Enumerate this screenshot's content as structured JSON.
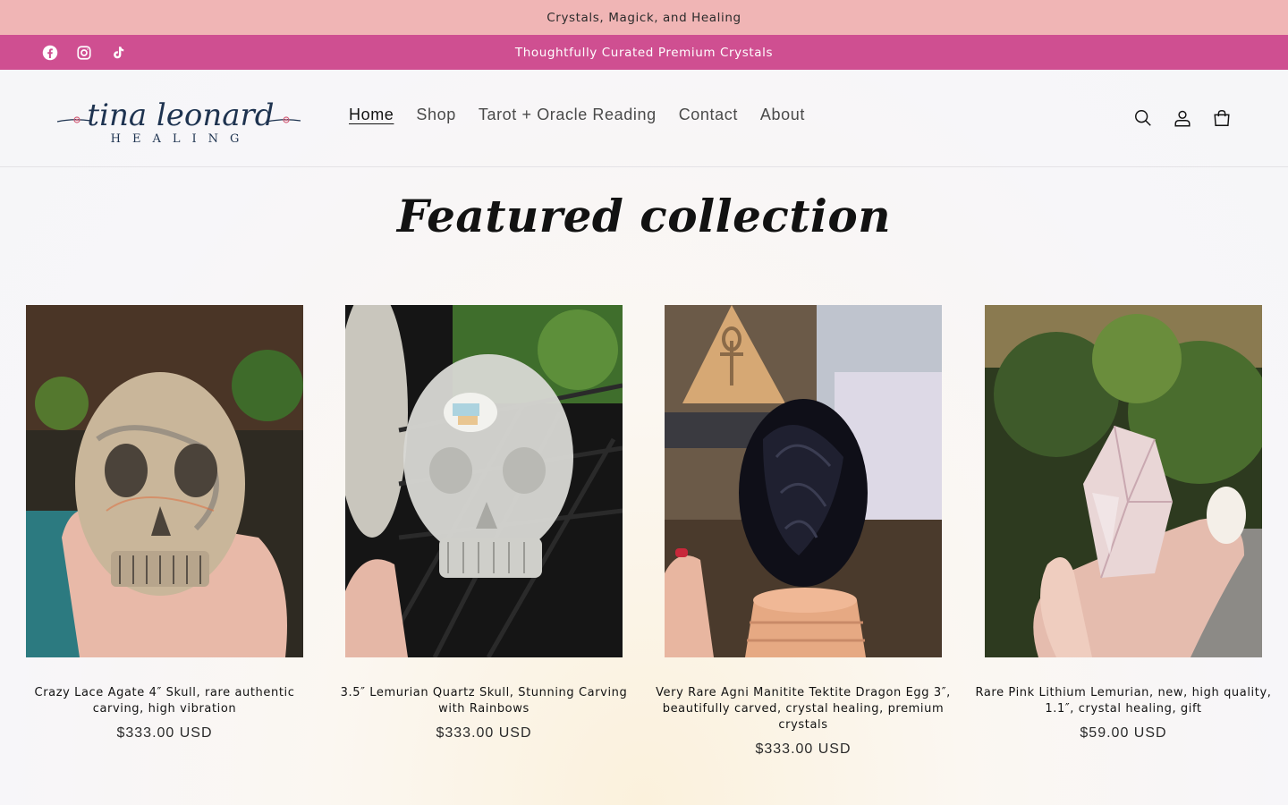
{
  "announcement": {
    "top_text": "Crystals, Magick, and Healing",
    "bar_text": "Thoughtfully Curated Premium Crystals"
  },
  "social": {
    "icons": [
      "facebook-icon",
      "instagram-icon",
      "tiktok-icon"
    ]
  },
  "brand": {
    "logo_text": "tina leonard",
    "logo_subtext": "HEALING"
  },
  "nav": {
    "items": [
      "Home",
      "Shop",
      "Tarot + Oracle Reading",
      "Contact",
      "About"
    ],
    "active": "Home"
  },
  "header_icons": [
    "search-icon",
    "account-icon",
    "cart-icon"
  ],
  "featured": {
    "title": "Featured collection",
    "products": [
      {
        "name": "Crazy Lace Agate 4″ Skull, rare authentic carving, high vibration",
        "price": "$333.00 USD"
      },
      {
        "name": "3.5″ Lemurian Quartz Skull, Stunning Carving with Rainbows",
        "price": "$333.00 USD"
      },
      {
        "name": "Very Rare Agni Manitite Tektite Dragon Egg 3″, beautifully carved, crystal healing, premium crystals",
        "price": "$333.00 USD"
      },
      {
        "name": "Rare Pink Lithium Lemurian, new, high quality, 1.1″, crystal healing, gift",
        "price": "$59.00 USD"
      }
    ]
  },
  "colors": {
    "top_bar": "#f0b5b5",
    "second_bar": "#cf4f91",
    "logo_navy": "#1e3350",
    "logo_pink": "#d4607a"
  }
}
